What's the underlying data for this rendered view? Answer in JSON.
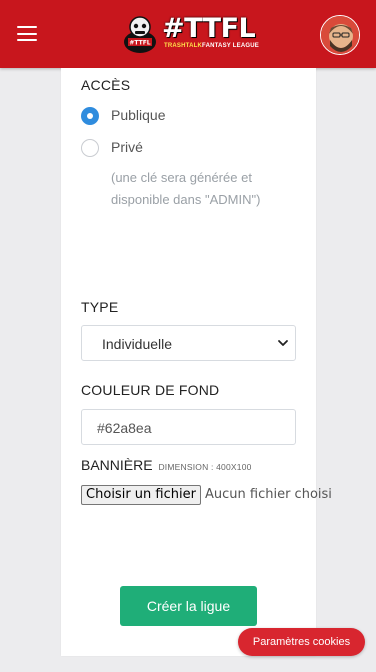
{
  "header": {
    "logo_text": "#TTFL",
    "tagline_prefix": "TRASHTALK",
    "tagline_suffix": "FANTASY LEAGUE",
    "brand_color": "#c8161d",
    "menu_icon": "hamburger-icon",
    "avatar_icon": "user-avatar"
  },
  "form": {
    "access": {
      "label": "ACCÈS",
      "options": [
        {
          "label": "Publique",
          "checked": true
        },
        {
          "label": "Privé",
          "checked": false
        }
      ],
      "hint": "(une clé sera générée et disponible dans \"ADMIN\")"
    },
    "type": {
      "label": "TYPE",
      "selected": "Individuelle"
    },
    "background_color": {
      "label": "COULEUR DE FOND",
      "value": "#62a8ea"
    },
    "banner": {
      "label": "BANNIÈRE",
      "dimension": "DIMENSION : 400X100",
      "button_label": "Choisir un fichier",
      "no_file_text": "Aucun fichier choisi"
    },
    "submit_label": "Créer la ligue",
    "submit_color": "#1fae78"
  },
  "cookies_button": "Paramètres cookies"
}
